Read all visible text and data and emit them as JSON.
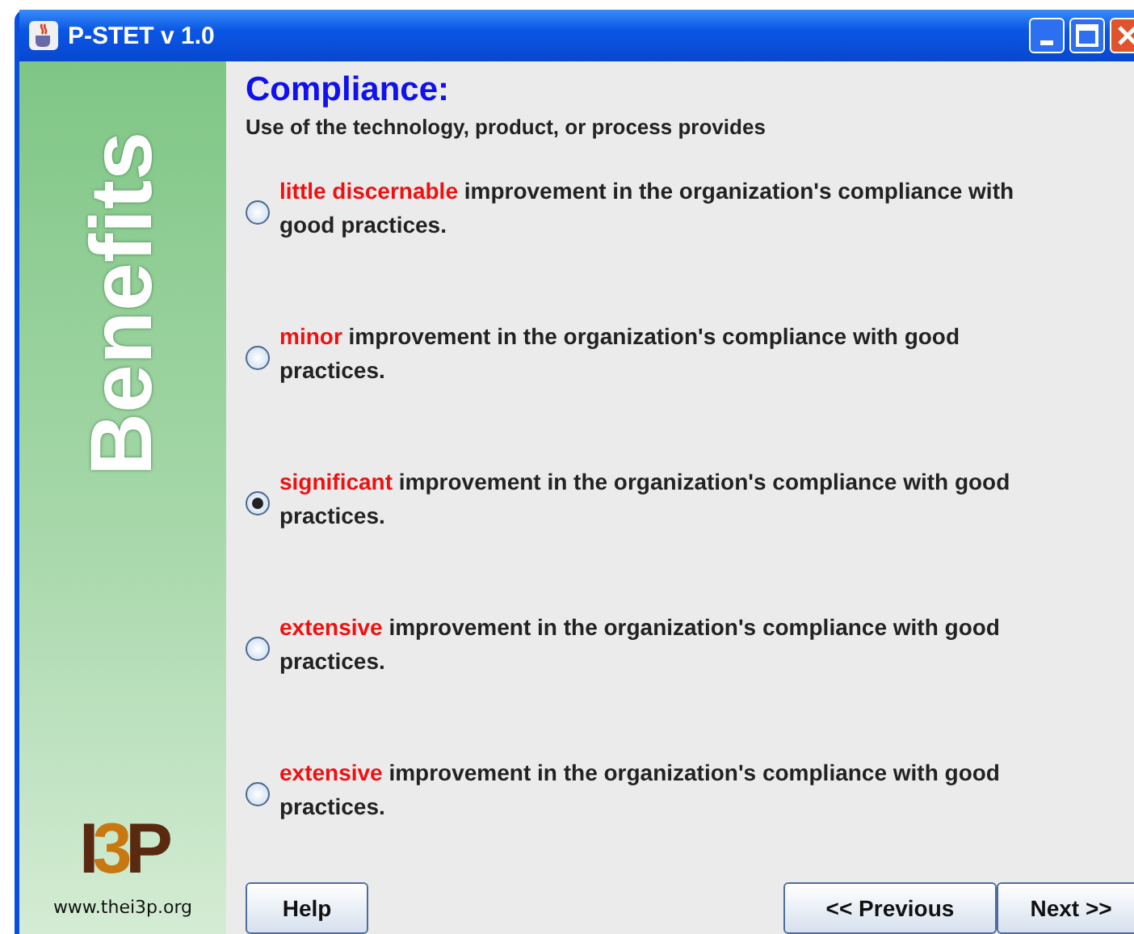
{
  "window": {
    "title": "P-STET v 1.0"
  },
  "sidebar": {
    "banner": "Benefits",
    "logo": "I3P",
    "url": "www.thei3p.org"
  },
  "heading": "Compliance:",
  "prompt": "Use of the technology, product, or process provides",
  "options": [
    {
      "highlight": "little discernable",
      "text": " improvement in the organization's compliance with good practices.",
      "selected": false
    },
    {
      "highlight": "minor",
      "text": " improvement in the organization's compliance with good practices.",
      "selected": false
    },
    {
      "highlight": "significant",
      "text": " improvement in the organization's compliance with good practices.",
      "selected": true
    },
    {
      "highlight": "extensive",
      "text": " improvement in the organization's compliance with good practices.",
      "selected": false
    },
    {
      "highlight": "extensive",
      "text": " improvement in the organization's compliance with good practices.",
      "selected": false
    }
  ],
  "buttons": {
    "help": "Help",
    "previous": "<< Previous",
    "next": "Next >>"
  }
}
